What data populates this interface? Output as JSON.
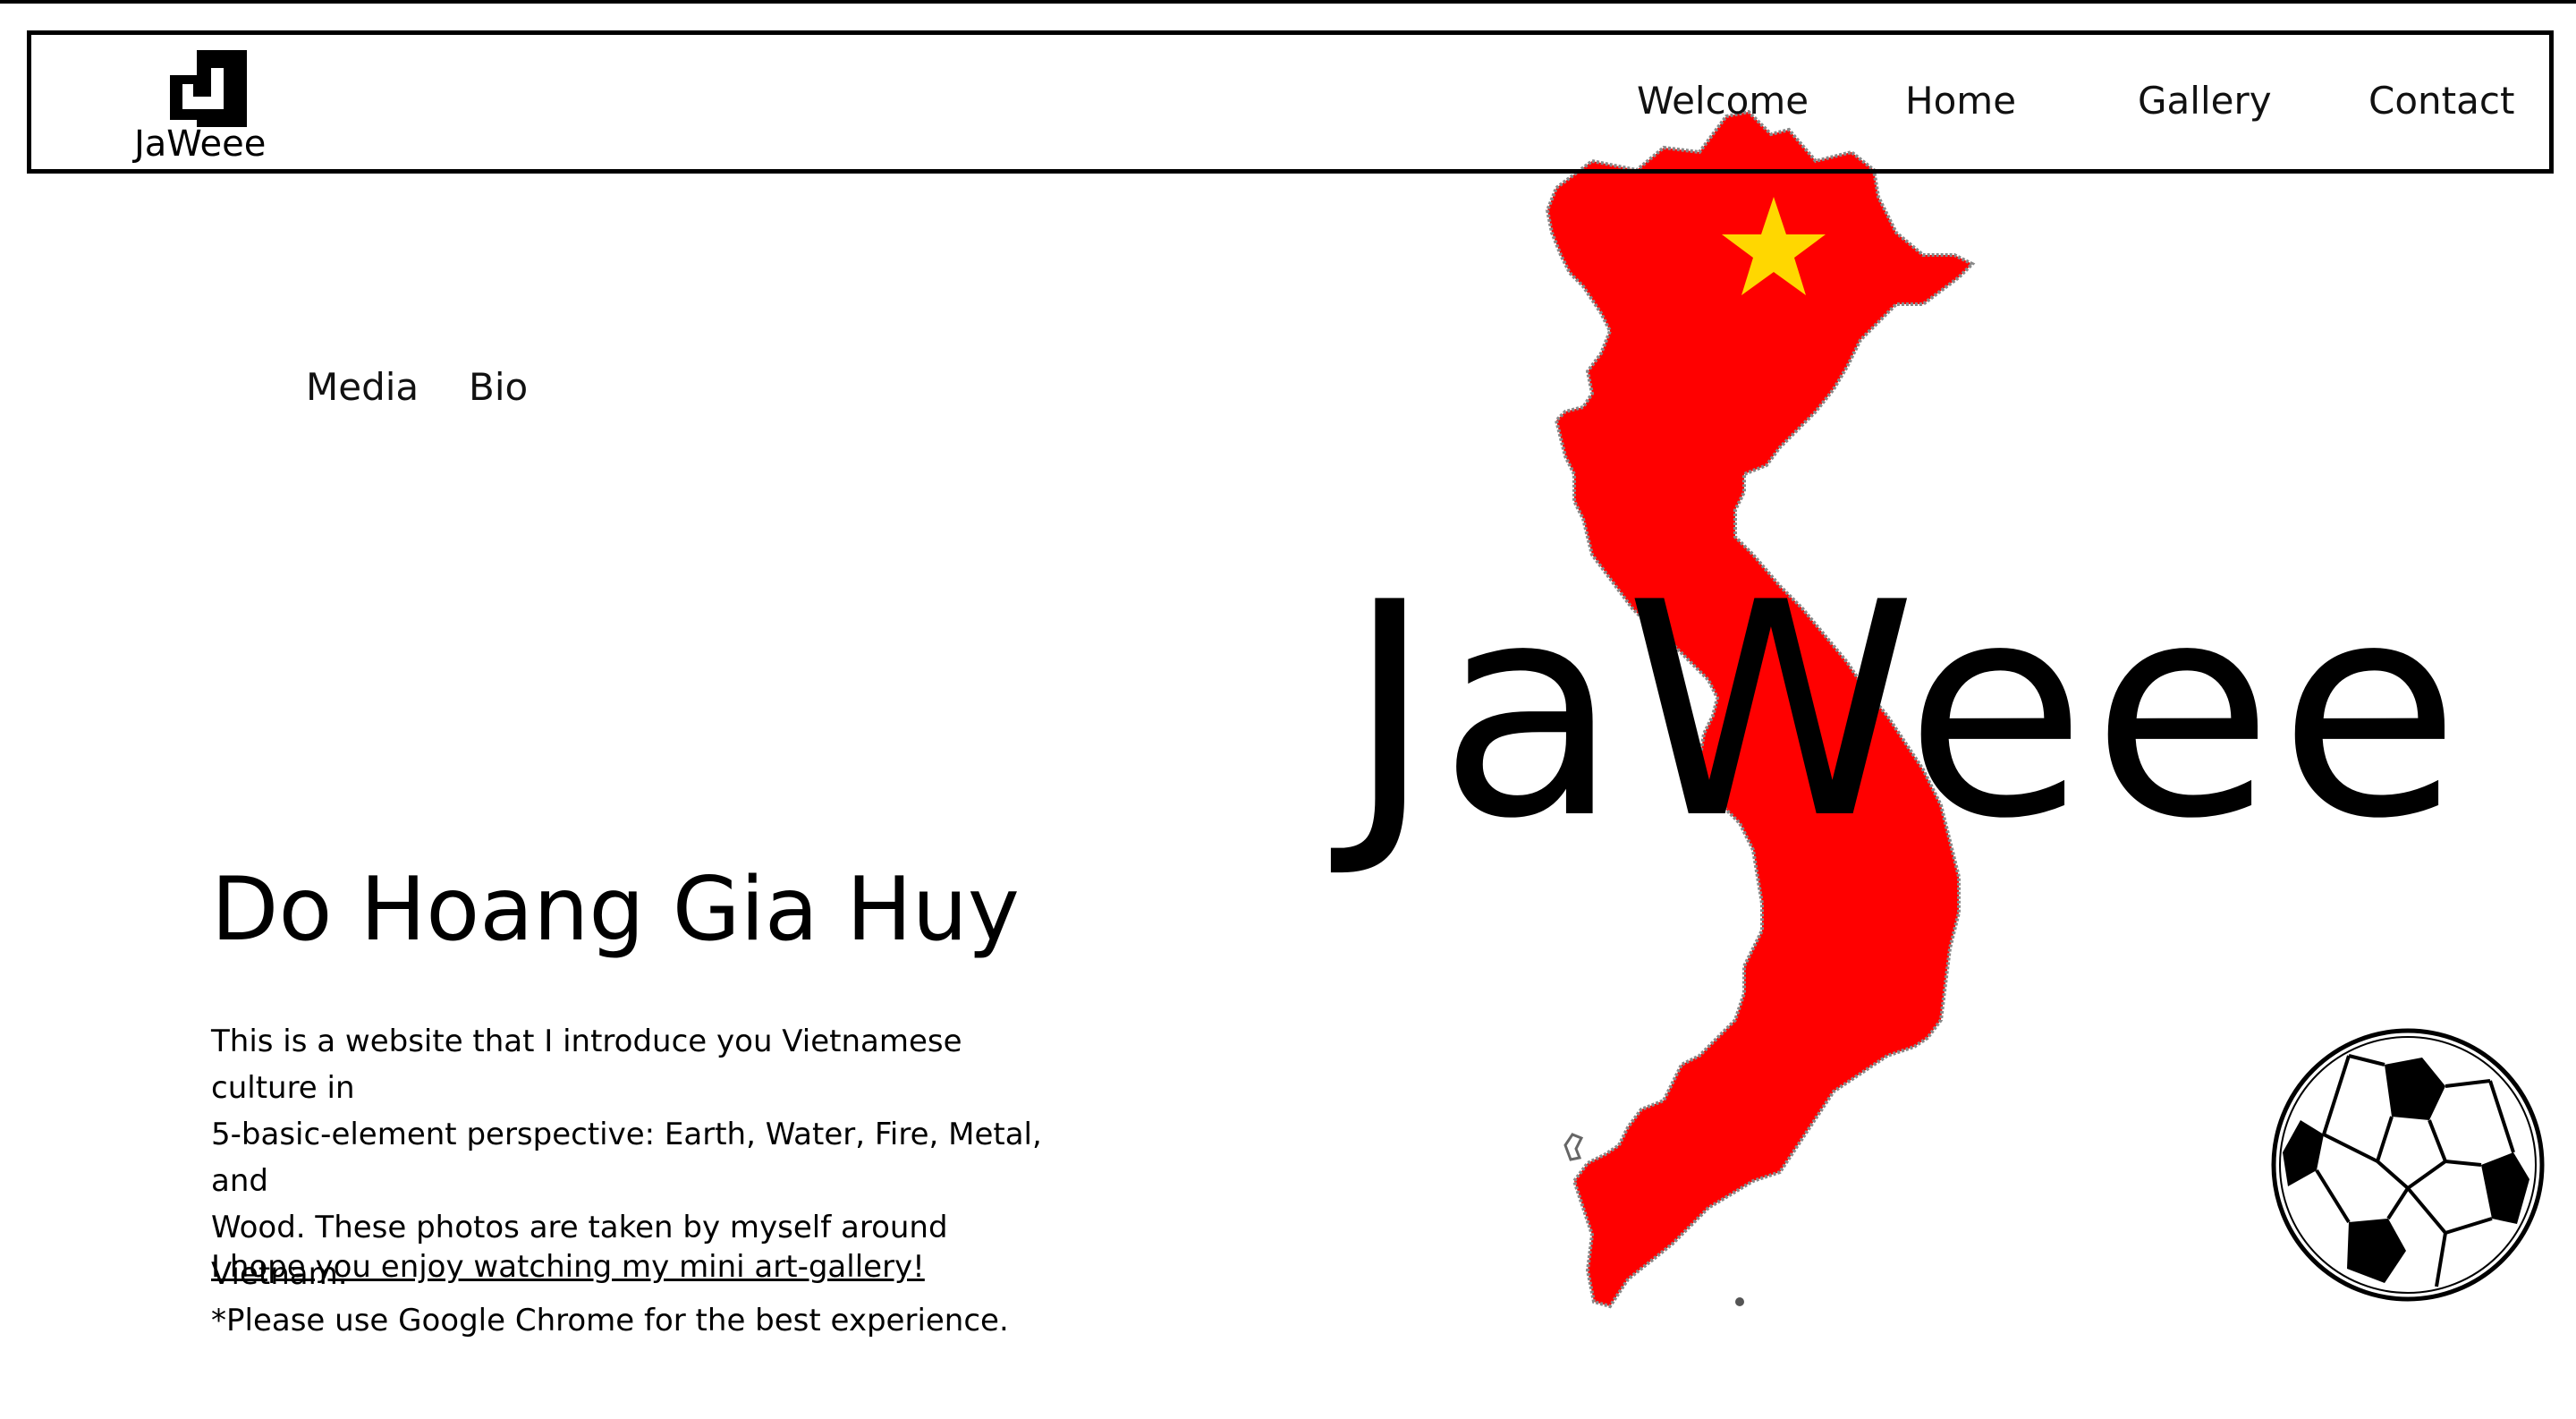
{
  "brand": {
    "logo_label": "JaWeee"
  },
  "nav": {
    "items": [
      {
        "label": "Welcome"
      },
      {
        "label": "Home"
      },
      {
        "label": "Gallery"
      },
      {
        "label": "Contact"
      }
    ]
  },
  "subnav": {
    "items": [
      {
        "label": "Media"
      },
      {
        "label": "Bio"
      }
    ]
  },
  "hero": {
    "title": "JaWeee"
  },
  "intro": {
    "name": "Do Hoang Gia Huy",
    "paragraph_lines": [
      "This is a website that I introduce you Vietnamese culture in",
      "5-basic-element perspective: Earth, Water, Fire, Metal, and",
      "Wood. These photos are taken by myself around Vietnam.",
      "*Please use Google Chrome for the best experience."
    ],
    "closing_link": "I hope you enjoy watching my mini art-gallery!"
  },
  "colors": {
    "map_red": "#ff0000",
    "star_yellow": "#ffd700",
    "text": "#000000",
    "background": "#ffffff"
  },
  "icons": {
    "logo": "jaweee-logo-icon",
    "map": "vietnam-map-icon",
    "star": "star-icon",
    "ball": "soccer-ball-icon"
  }
}
